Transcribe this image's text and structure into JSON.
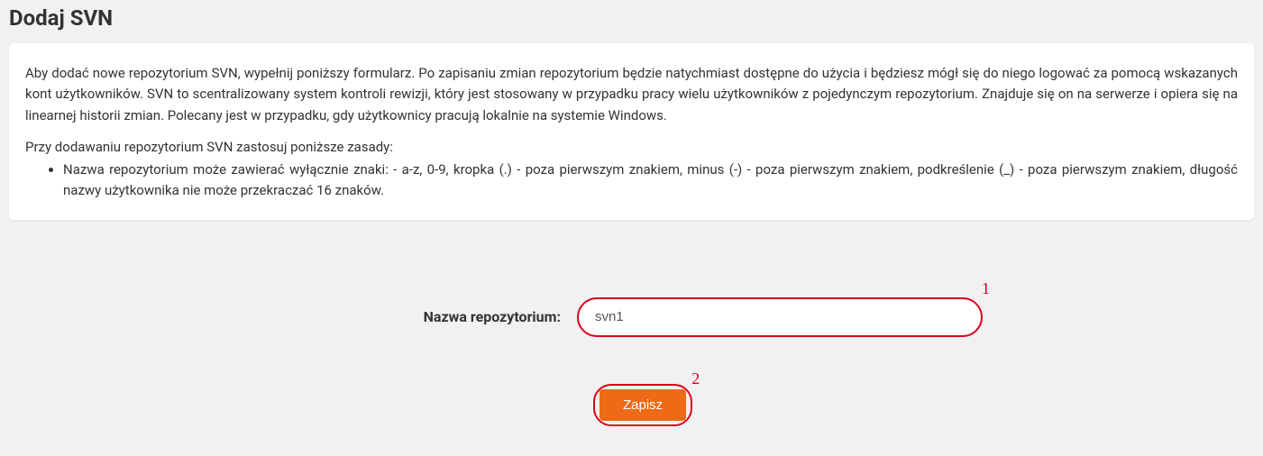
{
  "header": {
    "title": "Dodaj SVN"
  },
  "info": {
    "paragraph1": "Aby dodać nowe repozytorium SVN, wypełnij poniższy formularz. Po zapisaniu zmian repozytorium będzie natychmiast dostępne do użycia i będziesz mógł się do niego logować za pomocą wskazanych kont użytkowników. SVN to scentralizowany system kontroli rewizji, który jest stosowany w przypadku pracy wielu użytkowników z pojedynczym repozytorium. Znajduje się on na serwerze i opiera się na linearnej historii zmian. Polecany jest w przypadku, gdy użytkownicy pracują lokalnie na systemie Windows.",
    "rules_intro": "Przy dodawaniu repozytorium SVN zastosuj poniższe zasady:",
    "rule1": "Nazwa repozytorium może zawierać wyłącznie znaki: - a-z, 0-9, kropka (.) - poza pierwszym znakiem, minus (-) - poza pierwszym znakiem, podkreślenie (_) - poza pierwszym znakiem, długość nazwy użytkownika nie może przekraczać 16 znaków."
  },
  "form": {
    "repo_name_label": "Nazwa repozytorium:",
    "repo_name_value": "svn1",
    "save_label": "Zapisz"
  },
  "annotations": {
    "one": "1",
    "two": "2"
  }
}
